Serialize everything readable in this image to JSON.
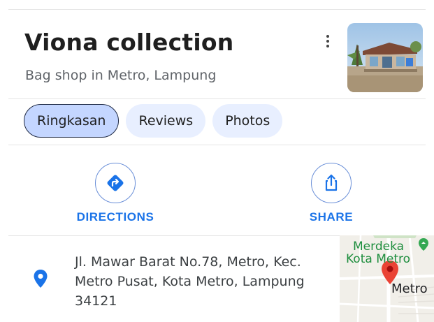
{
  "place": {
    "name": "Viona collection",
    "category": "Bag shop in Metro, Lampung"
  },
  "tabs": [
    {
      "label": "Ringkasan",
      "active": true
    },
    {
      "label": "Reviews",
      "active": false
    },
    {
      "label": "Photos",
      "active": false
    }
  ],
  "actions": {
    "directions": {
      "label": "DIRECTIONS",
      "icon": "directions-icon"
    },
    "share": {
      "label": "SHARE",
      "icon": "share-icon"
    }
  },
  "address": {
    "text": "Jl. Mawar Barat No.78, Metro, Kec. Metro Pusat, Kota Metro, Lampung 34121",
    "icon": "location-pin-icon"
  },
  "map_preview": {
    "label_line1": "Merdeka",
    "label_line2": "Kota Metro",
    "city_label": "Metro"
  },
  "colors": {
    "accent": "#1a73e8",
    "tab_bg": "#e8efff",
    "tab_active_bg": "#c4d6ff",
    "pin_red": "#ea4335",
    "map_green": "#1e8e3e"
  }
}
